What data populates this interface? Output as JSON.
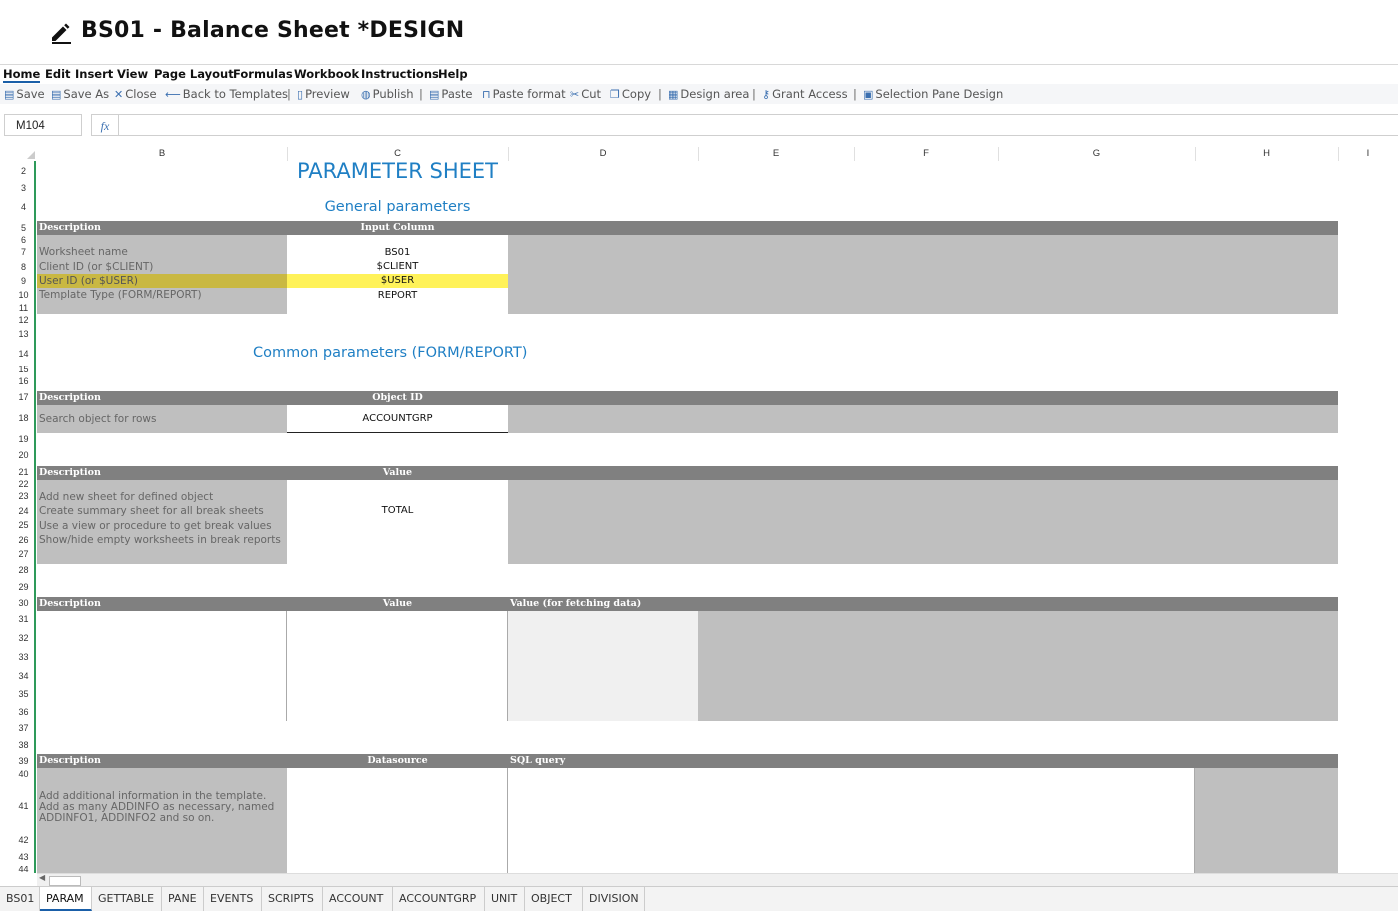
{
  "title": "BS01 - Balance Sheet *DESIGN",
  "menu": [
    "Home",
    "Edit",
    "Insert",
    "View",
    "Page Layout",
    "Formulas",
    "Workbook",
    "Instructions",
    "Help"
  ],
  "toolbar": {
    "save": "Save",
    "save_as": "Save As",
    "close": "Close",
    "back": "Back to Templates",
    "preview": "Preview",
    "publish": "Publish",
    "paste": "Paste",
    "paste_format": "Paste format",
    "cut": "Cut",
    "copy": "Copy",
    "design_area": "Design area",
    "grant_access": "Grant Access",
    "selection_pane": "Selection Pane Design",
    "sep": "|"
  },
  "formula": {
    "cell_ref": "M104",
    "fx": "fx",
    "value": ""
  },
  "columns": [
    "B",
    "C",
    "D",
    "E",
    "F",
    "G",
    "H",
    "I"
  ],
  "rows": [
    "2",
    "3",
    "4",
    "5",
    "6",
    "7",
    "8",
    "9",
    "10",
    "11",
    "12",
    "13",
    "14",
    "15",
    "16",
    "17",
    "18",
    "19",
    "20",
    "21",
    "22",
    "23",
    "24",
    "25",
    "26",
    "27",
    "28",
    "29",
    "30",
    "31",
    "32",
    "33",
    "34",
    "35",
    "36",
    "37",
    "38",
    "39",
    "40",
    "41",
    "42",
    "43",
    "44"
  ],
  "sheet": {
    "main_title": "PARAMETER SHEET",
    "general_title": "General parameters",
    "common_title": "Common parameters (FORM/REPORT)",
    "sec1": {
      "h1": "Description",
      "h2": "Input Column",
      "labels": [
        "Worksheet name",
        "Client ID (or $CLIENT)",
        "User ID (or $USER)",
        "Template Type (FORM/REPORT)"
      ],
      "values": [
        "BS01",
        "$CLIENT",
        "$USER",
        "REPORT"
      ]
    },
    "sec2": {
      "h1": "Description",
      "h2": "Object ID",
      "label": "Search object for rows",
      "value": "ACCOUNTGRP"
    },
    "sec3": {
      "h1": "Description",
      "h2": "Value",
      "labels": [
        "Add new sheet for defined object",
        "Create summary sheet for all break sheets",
        "Use a view or procedure to get break values",
        "Show/hide empty worksheets in break reports"
      ],
      "value": "TOTAL"
    },
    "sec4": {
      "h1": "Description",
      "h2": "Value",
      "h3": "Value (for fetching data)"
    },
    "sec5": {
      "h1": "Description",
      "h2": "Datasource",
      "h3": "SQL query",
      "label_lines": [
        "Add additional information in the template.",
        "Add as many ADDINFO as necessary, named",
        "ADDINFO1, ADDINFO2 and so on."
      ]
    }
  },
  "tabs": [
    "BS01",
    "PARAM",
    "GETTABLE",
    "PANE",
    "EVENTS",
    "SCRIPTS",
    "ACCOUNT",
    "ACCOUNTGRP",
    "UNIT",
    "OBJECT",
    "DIVISION"
  ],
  "active_tab": "PARAM",
  "colors": {
    "header_band": "#808080",
    "gray_fill": "#bfbfbf",
    "highlight": "#fff450",
    "title_blue": "#1f7fc4",
    "row_marker": "#2e9a5a"
  }
}
